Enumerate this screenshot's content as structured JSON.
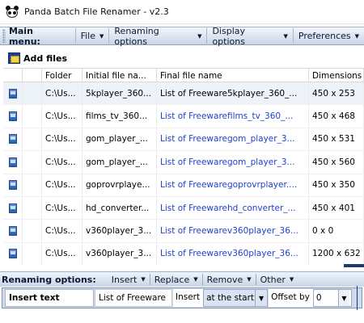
{
  "window": {
    "title": "Panda Batch File Renamer - v2.3"
  },
  "main_menu": {
    "caption": "Main menu:",
    "items": [
      {
        "label": "File"
      },
      {
        "label": "Renaming options"
      },
      {
        "label": "Display options"
      },
      {
        "label": "Preferences"
      }
    ]
  },
  "toolbar": {
    "add_files": "Add files"
  },
  "grid": {
    "headers": {
      "folder": "Folder",
      "initial": "Initial file na...",
      "final": "Final file name",
      "dimensions": "Dimensions"
    },
    "rows": [
      {
        "folder": "C:\\Us...",
        "initial": "5kplayer_360...",
        "final": "List of Freeware5kplayer_360_...",
        "dimensions": "450 x 253"
      },
      {
        "folder": "C:\\Us...",
        "initial": "films_tv_360...",
        "final": "List of Freewarefilms_tv_360_...",
        "dimensions": "450 x 468"
      },
      {
        "folder": "C:\\Us...",
        "initial": "gom_player_...",
        "final": "List of Freewaregom_player_3...",
        "dimensions": "450 x 531"
      },
      {
        "folder": "C:\\Us...",
        "initial": "gom_player_...",
        "final": "List of Freewaregom_player_3...",
        "dimensions": "450 x 560"
      },
      {
        "folder": "C:\\Us...",
        "initial": "goprovrplaye...",
        "final": "List of Freewaregoprovrplayer....",
        "dimensions": "450 x 350"
      },
      {
        "folder": "C:\\Us...",
        "initial": "hd_converter...",
        "final": "List of Freewarehd_converter_...",
        "dimensions": "450 x 401"
      },
      {
        "folder": "C:\\Us...",
        "initial": "v360player_3...",
        "final": "List of Freewarev360player_36...",
        "dimensions": "0 x 0"
      },
      {
        "folder": "C:\\Us...",
        "initial": "v360player_3...",
        "final": "List of Freewarev360player_36...",
        "dimensions": "1200 x 632"
      }
    ]
  },
  "renaming_bar": {
    "caption": "Renaming options:",
    "items": [
      {
        "label": "Insert"
      },
      {
        "label": "Replace"
      },
      {
        "label": "Remove"
      },
      {
        "label": "Other"
      }
    ]
  },
  "insert_options": {
    "caption": "Insert text",
    "text_value": "List of Freeware",
    "insert_label": "Insert",
    "position_value": "at the start",
    "offset_label": "Offset by",
    "offset_value": "0"
  }
}
